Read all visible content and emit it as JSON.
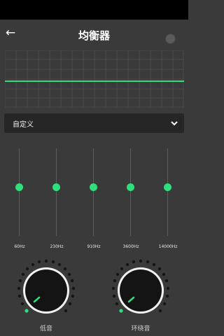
{
  "header": {
    "title": "均衡器",
    "back_icon": "back-arrow-icon"
  },
  "preset": {
    "selected": "自定义"
  },
  "bands": [
    {
      "label": "60Hz",
      "level": 0
    },
    {
      "label": "230Hz",
      "level": 0
    },
    {
      "label": "910Hz",
      "level": 0
    },
    {
      "label": "3600Hz",
      "level": 0
    },
    {
      "label": "14000Hz",
      "level": 0
    }
  ],
  "knobs": {
    "bass": {
      "label": "低音",
      "level": 0
    },
    "surround": {
      "label": "环绕音",
      "level": 0
    }
  },
  "colors": {
    "accent": "#2ee07d",
    "background": "#3a3a3a",
    "panel": "#262626"
  }
}
